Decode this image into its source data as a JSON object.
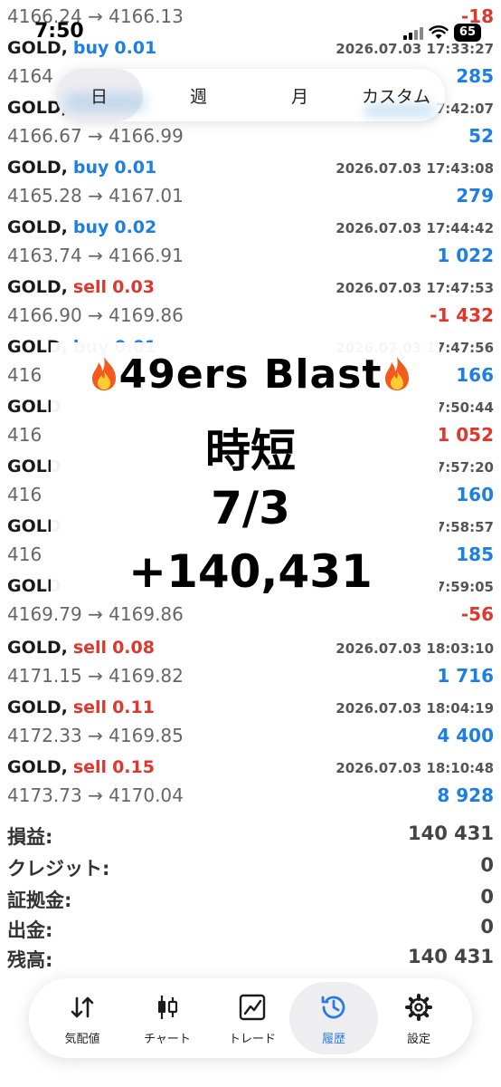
{
  "status_bar": {
    "time": "7:50",
    "battery": "65"
  },
  "colors": {
    "buy": "#1b7fe3",
    "sell": "#e0362b",
    "accent": "#2b7be4"
  },
  "period_tabs": [
    "日",
    "週",
    "月",
    "カスタム"
  ],
  "trades": [
    {
      "symbol": "",
      "side": "",
      "lots": "",
      "date": "",
      "prices": "4166.24 → 4166.13",
      "profit": "-18",
      "profit_color": "sell"
    },
    {
      "symbol": "GOLD,",
      "side": "buy",
      "lots": "0.01",
      "date": "2026.07.03 17:33:27",
      "prices": "4164",
      "profit": "285",
      "profit_color": "buy"
    },
    {
      "symbol": "GOLD,",
      "side": "",
      "lots": "",
      "date": "7:42:07",
      "prices": "4166.67 → 4166.99",
      "profit": "52",
      "profit_color": "buy"
    },
    {
      "symbol": "GOLD,",
      "side": "buy",
      "lots": "0.01",
      "date": "2026.07.03 17:43:08",
      "prices": "4165.28 → 4167.01",
      "profit": "279",
      "profit_color": "buy"
    },
    {
      "symbol": "GOLD,",
      "side": "buy",
      "lots": "0.02",
      "date": "2026.07.03 17:44:42",
      "prices": "4163.74 → 4166.91",
      "profit": "1 022",
      "profit_color": "buy"
    },
    {
      "symbol": "GOLD,",
      "side": "sell",
      "lots": "0.03",
      "date": "2026.07.03 17:47:53",
      "prices": "4166.90 → 4169.86",
      "profit": "-1 432",
      "profit_color": "sell"
    },
    {
      "symbol": "GOLD,",
      "side": "buy",
      "lots": "0.01",
      "date": "2026.07.03 17:47:56",
      "prices": "416",
      "profit": "166",
      "profit_color": "buy"
    },
    {
      "symbol": "GOLD",
      "side": "",
      "lots": "",
      "date": "7:50:44",
      "prices": "416",
      "profit": "1 052",
      "profit_color": "sell"
    },
    {
      "symbol": "GOLD",
      "side": "",
      "lots": "",
      "date": "7:57:20",
      "prices": "416",
      "profit": "160",
      "profit_color": "buy"
    },
    {
      "symbol": "GOLD",
      "side": "",
      "lots": "",
      "date": "7:58:57",
      "prices": "416",
      "profit": "185",
      "profit_color": "buy"
    },
    {
      "symbol": "GOLD",
      "side": "",
      "lots": "",
      "date": "7:59:05",
      "prices": "4169.79 → 4169.86",
      "profit": "-56",
      "profit_color": "sell"
    },
    {
      "symbol": "GOLD,",
      "side": "sell",
      "lots": "0.08",
      "date": "2026.07.03 18:03:10",
      "prices": "4171.15 → 4169.82",
      "profit": "1 716",
      "profit_color": "buy"
    },
    {
      "symbol": "GOLD,",
      "side": "sell",
      "lots": "0.11",
      "date": "2026.07.03 18:04:19",
      "prices": "4172.33 → 4169.85",
      "profit": "4 400",
      "profit_color": "buy"
    },
    {
      "symbol": "GOLD,",
      "side": "sell",
      "lots": "0.15",
      "date": "2026.07.03 18:10:48",
      "prices": "4173.73 → 4170.04",
      "profit": "8 928",
      "profit_color": "buy"
    }
  ],
  "overlay": {
    "title": "49ers Blast",
    "line1": "時短",
    "line2": "7/3",
    "line3": "+140,431"
  },
  "summary": [
    {
      "label": "損益:",
      "value": "140 431"
    },
    {
      "label": "クレジット:",
      "value": "0"
    },
    {
      "label": "証拠金:",
      "value": "0"
    },
    {
      "label": "出金:",
      "value": "0"
    },
    {
      "label": "残高:",
      "value": "140 431"
    }
  ],
  "tab_bar": [
    {
      "label": "気配値",
      "icon": "arrows-updown-icon"
    },
    {
      "label": "チャート",
      "icon": "candlestick-icon"
    },
    {
      "label": "トレード",
      "icon": "trade-chart-icon"
    },
    {
      "label": "履歴",
      "icon": "history-clock-icon",
      "active": true
    },
    {
      "label": "設定",
      "icon": "gear-icon"
    }
  ]
}
